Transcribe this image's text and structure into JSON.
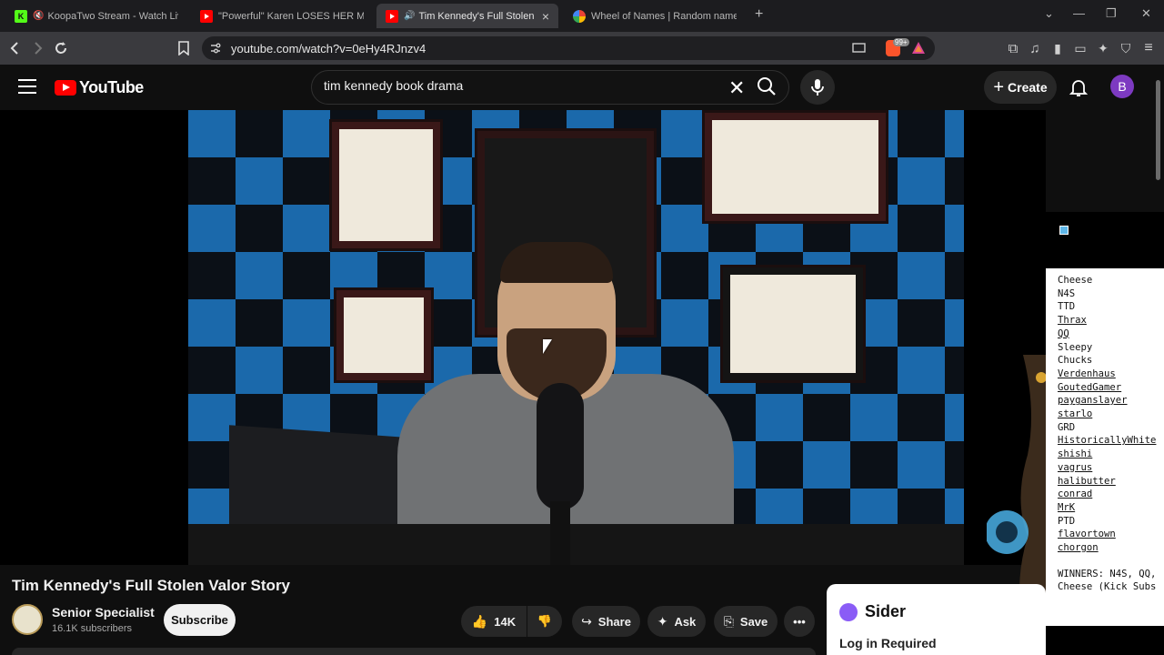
{
  "browser": {
    "tabs": [
      {
        "title": "KoopaTwo Stream - Watch Live o",
        "favicon": "K",
        "color": "#53fc18"
      },
      {
        "title": "\"Powerful\" Karen LOSES HER MIND W",
        "favicon": "yt",
        "color": "#ff0000"
      },
      {
        "title": "Tim Kennedy's Full Stolen Val",
        "favicon": "yt",
        "color": "#ff0000"
      },
      {
        "title": "Wheel of Names | Random name pic",
        "favicon": "wheel",
        "color": "#4285f4"
      }
    ],
    "url": "youtube.com/watch?v=0eHy4RJnzv4",
    "extension_badge": "99+"
  },
  "youtube": {
    "logo_text": "YouTube",
    "search_value": "tim kennedy book drama",
    "create_label": "Create",
    "avatar_letter": "B"
  },
  "video": {
    "title": "Tim Kennedy's Full Stolen Valor Story",
    "channel_name": "Senior Specialist",
    "subscribers": "16.1K subscribers",
    "subscribe_label": "Subscribe",
    "likes": "14K",
    "share_label": "Share",
    "ask_label": "Ask",
    "save_label": "Save"
  },
  "overlay": {
    "names": [
      {
        "name": "Cheese",
        "u": false
      },
      {
        "name": "N4S",
        "u": false
      },
      {
        "name": "TTD",
        "u": false
      },
      {
        "name": "Thrax",
        "u": true
      },
      {
        "name": "QQ",
        "u": true
      },
      {
        "name": "Sleepy",
        "u": false
      },
      {
        "name": "Chucks",
        "u": false
      },
      {
        "name": "Verdenhaus",
        "u": true
      },
      {
        "name": "GoutedGamer",
        "u": true
      },
      {
        "name": "payganslayer",
        "u": true
      },
      {
        "name": "starlo",
        "u": true
      },
      {
        "name": "GRD",
        "u": false
      },
      {
        "name": "HistoricallyWhite",
        "u": true
      },
      {
        "name": "shishi",
        "u": true
      },
      {
        "name": "vagrus",
        "u": true
      },
      {
        "name": "halibutter",
        "u": true
      },
      {
        "name": "conrad",
        "u": true
      },
      {
        "name": "MrK",
        "u": true
      },
      {
        "name": "PTD",
        "u": false
      },
      {
        "name": "flavortown",
        "u": true
      },
      {
        "name": "chorgon",
        "u": true
      }
    ],
    "winners_line1": "WINNERS: N4S, QQ,",
    "winners_line2": "Cheese (Kick Subs"
  },
  "sider": {
    "brand": "Sider",
    "login": "Log in Required"
  }
}
